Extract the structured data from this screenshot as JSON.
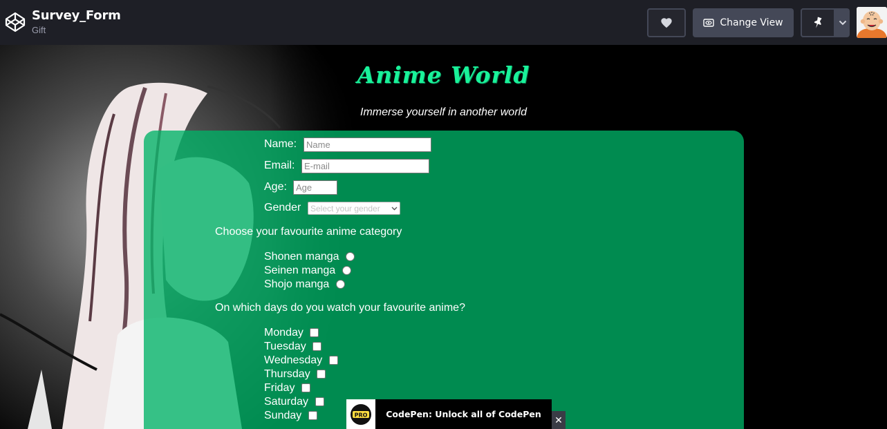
{
  "header": {
    "pen_title": "Survey_Form",
    "author": "Gift",
    "change_view_label": "Change View"
  },
  "preview": {
    "title": "Anime World",
    "subtitle": "Immerse yourself in another world",
    "form": {
      "name": {
        "label": "Name:",
        "placeholder": "Name"
      },
      "email": {
        "label": "Email:",
        "placeholder": "E-mail"
      },
      "age": {
        "label": "Age:",
        "placeholder": "Age"
      },
      "gender": {
        "label": "Gender",
        "placeholder": "Select your gender"
      },
      "category_question": "Choose your favourite anime category",
      "categories": [
        "Shonen manga",
        "Seinen manga",
        "Shojo manga"
      ],
      "days_question": "On which days do you watch your favourite anime?",
      "days": [
        "Monday",
        "Tuesday",
        "Wednesday",
        "Thursday",
        "Friday",
        "Saturday",
        "Sunday"
      ]
    }
  },
  "promo": {
    "badge": "PRO",
    "text": "CodePen: Unlock all of CodePen",
    "close": "✕"
  },
  "colors": {
    "accent_green": "#19f29a",
    "form_bg": "#00b266",
    "topbar_bg": "#1e1f26"
  }
}
